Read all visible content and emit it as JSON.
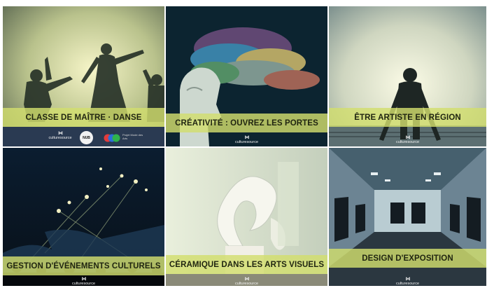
{
  "tiles": [
    {
      "title": "CLASSE DE MAÎTRE · DANSE"
    },
    {
      "title": "CRÉATIVITÉ : OUVREZ LES PORTES"
    },
    {
      "title": "ÊTRE ARTISTE EN RÉGION"
    },
    {
      "title": "GESTION D'ÉVÉNEMENTS CULTURELS"
    },
    {
      "title": "CÉRAMIQUE DANS LES ARTS VISUELS"
    },
    {
      "title": "DESIGN D'EXPOSITION"
    }
  ],
  "brand": {
    "mark": "⋈",
    "name": "culturesource"
  },
  "partners": {
    "circle_label": "NUB",
    "colorful_label": "Projet Mode des Arts"
  },
  "colors": {
    "band": "#d2de6e",
    "band_text": "#1f2410"
  }
}
